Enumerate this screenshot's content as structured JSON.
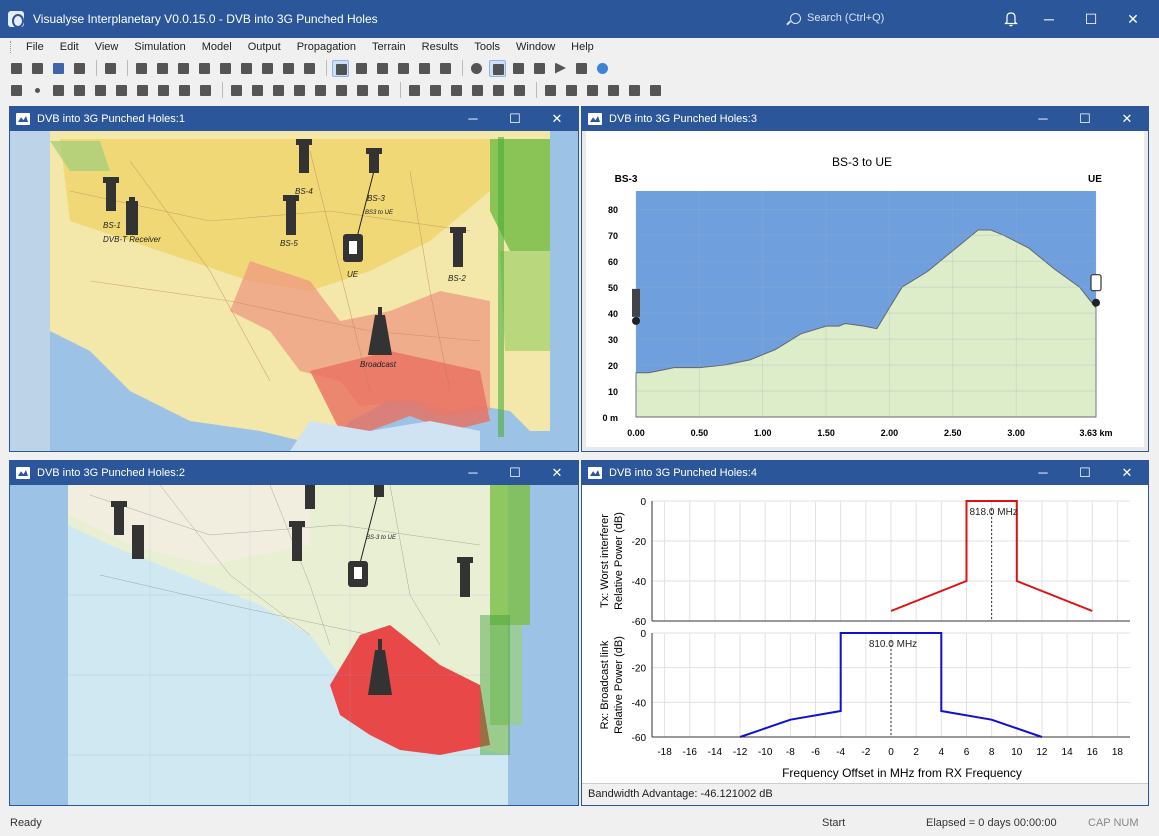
{
  "app": {
    "title": "Visualyse Interplanetary V0.0.15.0 - DVB into 3G Punched Holes",
    "search_placeholder": "Search (Ctrl+Q)"
  },
  "window_controls": {
    "minimize": "─",
    "maximize": "☐",
    "close": "✕",
    "bell": "🔔"
  },
  "menu": [
    "File",
    "Edit",
    "View",
    "Simulation",
    "Model",
    "Output",
    "Propagation",
    "Terrain",
    "Results",
    "Tools",
    "Window",
    "Help"
  ],
  "windows": {
    "w1": {
      "title": "DVB into 3G Punched Holes:1"
    },
    "w2": {
      "title": "DVB into 3G Punched Holes:2"
    },
    "w3": {
      "title": "DVB into 3G Punched Holes:3"
    },
    "w4": {
      "title": "DVB into 3G Punched Holes:4"
    }
  },
  "map1_labels": {
    "bs1": "BS-1",
    "dvbt": "DVB-T Receiver",
    "bs4": "BS-4",
    "bs3": "BS-3",
    "bs3ue": "BS3 to UE",
    "bs5": "BS-5",
    "ue": "UE",
    "bs2": "BS-2",
    "broadcast": "Broadcast"
  },
  "map2_labels": {
    "bs3ue": "BS-3 to UE"
  },
  "chart_data": [
    {
      "type": "area",
      "title": "BS-3  to  UE",
      "left_label": "BS-3",
      "right_label": "UE",
      "ylabel": "m",
      "xlabel": "km",
      "ylim": [
        0,
        87
      ],
      "xlim": [
        0,
        3.63
      ],
      "x_ticks": [
        "0.00",
        "0.50",
        "1.00",
        "1.50",
        "2.00",
        "2.50",
        "3.00",
        "3.63 km"
      ],
      "y_ticks": [
        "0 m",
        "10",
        "20",
        "30",
        "40",
        "50",
        "60",
        "70",
        "80"
      ],
      "terrain_x": [
        0,
        0.1,
        0.2,
        0.3,
        0.5,
        0.7,
        0.9,
        1.1,
        1.3,
        1.5,
        1.6,
        1.65,
        1.8,
        1.9,
        2.0,
        2.1,
        2.3,
        2.5,
        2.6,
        2.7,
        2.8,
        2.9,
        3.1,
        3.3,
        3.5,
        3.63
      ],
      "terrain_y": [
        17,
        17,
        18,
        19,
        19,
        20,
        22,
        26,
        32,
        35,
        35,
        36,
        35,
        34,
        42,
        50,
        56,
        64,
        68,
        72,
        72,
        70,
        65,
        57,
        50,
        42
      ],
      "tx_height": 37,
      "rx_height": 44
    },
    {
      "type": "line",
      "xlabel": "Frequency Offset in MHz from RX Frequency",
      "x_ticks": [
        -18,
        -16,
        -14,
        -12,
        -10,
        -8,
        -6,
        -4,
        -2,
        0,
        2,
        4,
        6,
        8,
        10,
        12,
        14,
        16,
        18
      ],
      "xlim": [
        -19,
        19
      ],
      "panels": [
        {
          "ylabel_line1": "Tx: Worst interferer",
          "ylabel_line2": "Relative Power (dB)",
          "ylim": [
            -60,
            0
          ],
          "y_ticks": [
            0,
            -20,
            -40,
            -60
          ],
          "color": "#e01010",
          "x": [
            0,
            4,
            6,
            6,
            10,
            10,
            12,
            16
          ],
          "y": [
            -55,
            -45,
            -40,
            0,
            0,
            -40,
            -45,
            -55
          ],
          "marker_freq": 8,
          "marker_label": "818.0 MHz"
        },
        {
          "ylabel_line1": "Rx: Broadcast link",
          "ylabel_line2": "Relative Power (dB)",
          "ylim": [
            -60,
            0
          ],
          "y_ticks": [
            0,
            -20,
            -40,
            -60
          ],
          "color": "#1010d0",
          "x": [
            -12,
            -8,
            -4,
            -4,
            4,
            4,
            8,
            12
          ],
          "y": [
            -60,
            -50,
            -45,
            0,
            0,
            -45,
            -50,
            -60
          ],
          "marker_freq": 0,
          "marker_label": "810.0 MHz"
        }
      ]
    }
  ],
  "bandwidth_advantage": "Bandwidth Advantage: -46.121002 dB",
  "status": {
    "ready": "Ready",
    "start": "Start",
    "elapsed": "Elapsed = 0 days 00:00:00",
    "caps": "CAP  NUM"
  },
  "colors": {
    "accent": "#2b579a",
    "sea": "#9cc3e6",
    "terrain": "#ddedc9",
    "sky": "#6f9fdc"
  }
}
